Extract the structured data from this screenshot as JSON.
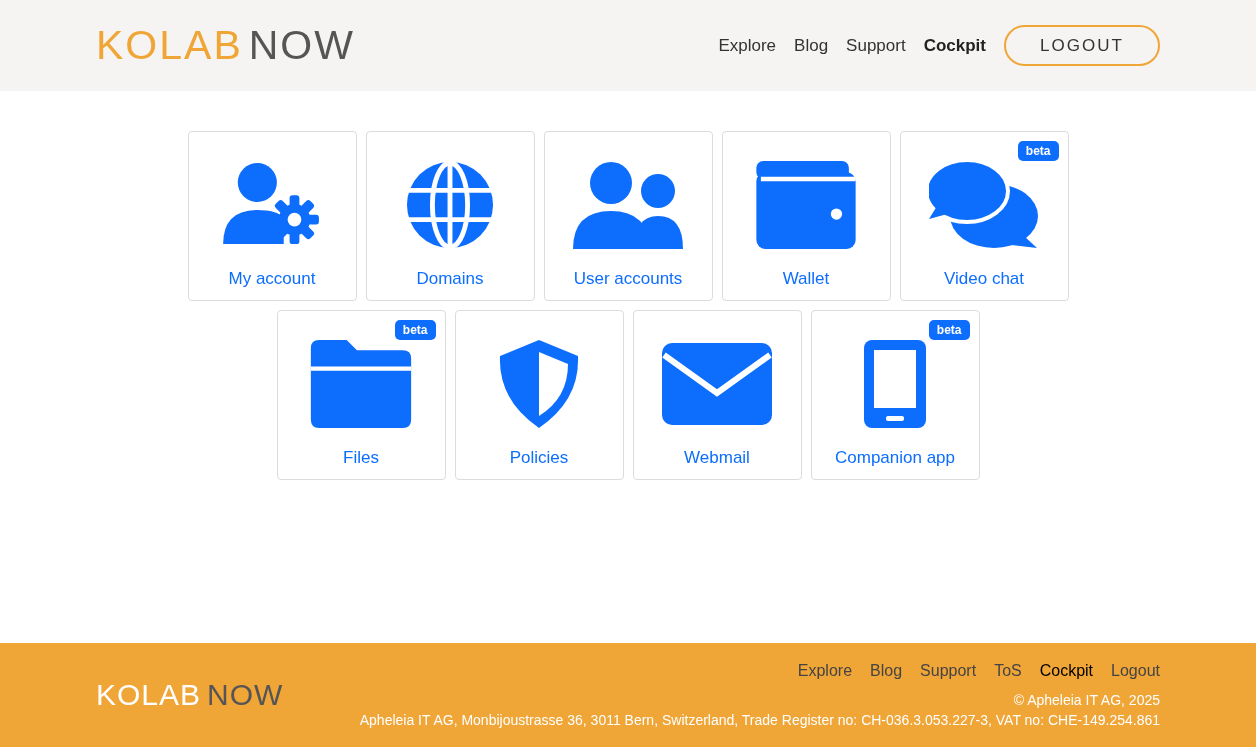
{
  "header": {
    "logo": {
      "part_1": "KOLAB",
      "part_2": "NOW"
    },
    "nav": [
      {
        "label": "Explore",
        "selected": false
      },
      {
        "label": "Blog",
        "selected": false
      },
      {
        "label": "Support",
        "selected": false
      },
      {
        "label": "Cockpit",
        "selected": true
      }
    ],
    "logout_button": "LOGOUT"
  },
  "tiles": [
    {
      "kind": "account",
      "label": "My account"
    },
    {
      "kind": "globe",
      "label": "Domains"
    },
    {
      "kind": "users",
      "label": "User accounts"
    },
    {
      "kind": "wallet",
      "label": "Wallet"
    },
    {
      "kind": "chat",
      "label": "Video chat",
      "badge": "beta"
    },
    {
      "kind": "folder",
      "label": "Files",
      "badge": "beta"
    },
    {
      "kind": "shield",
      "label": "Policies"
    },
    {
      "kind": "mail",
      "label": "Webmail"
    },
    {
      "kind": "phone",
      "label": "Companion app",
      "badge": "beta"
    }
  ],
  "footer": {
    "logo": {
      "part_1": "KOLAB",
      "part_2": "NOW"
    },
    "links": [
      {
        "label": "Explore",
        "selected": false
      },
      {
        "label": "Blog",
        "selected": false
      },
      {
        "label": "Support",
        "selected": false
      },
      {
        "label": "ToS",
        "selected": false
      },
      {
        "label": "Cockpit",
        "selected": true
      },
      {
        "label": "Logout",
        "selected": false
      }
    ],
    "copyright": "© Apheleia IT AG, 2025",
    "address": "Apheleia IT AG, Monbijoustrasse 36, 3011 Bern, Switzerland, Trade Register no: CH-036.3.053.227-3, VAT no: CHE-149.254.861"
  }
}
